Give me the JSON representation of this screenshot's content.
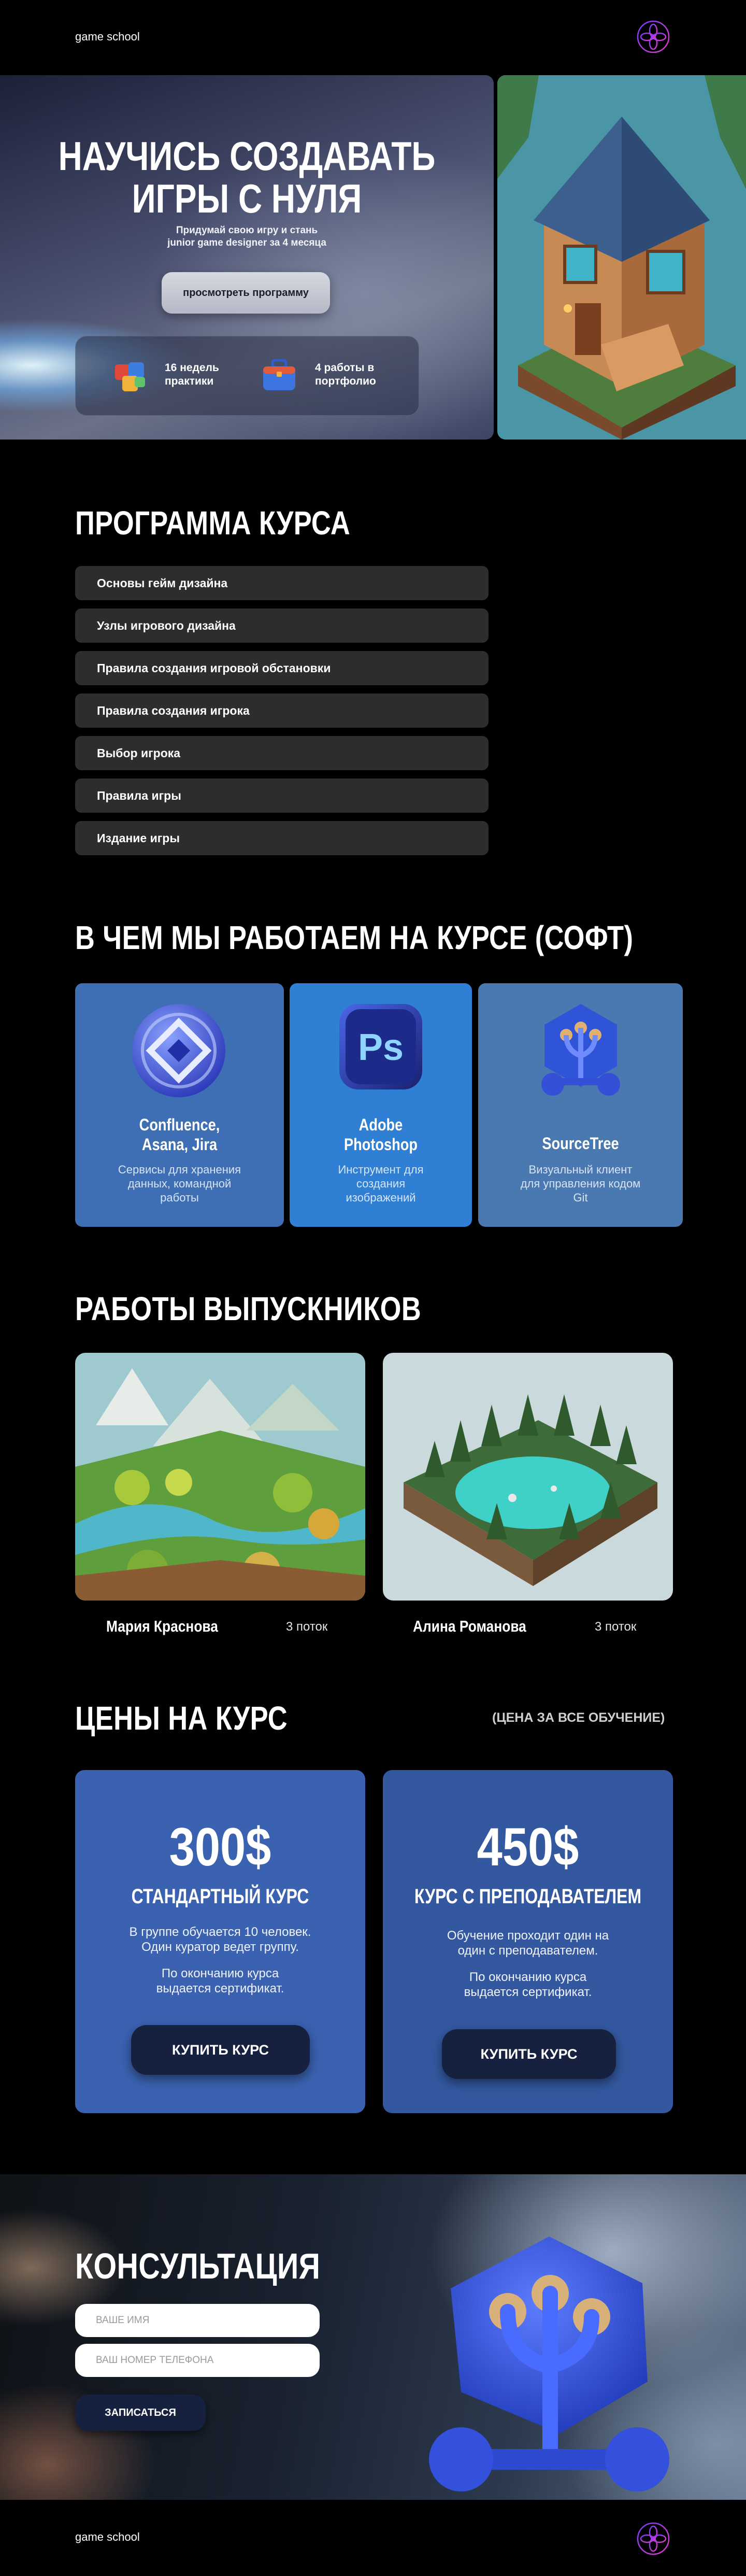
{
  "header": {
    "brand": "game school",
    "logo_icon": "neural-flower-icon"
  },
  "hero": {
    "title_line1": "НАУЧИСЬ СОЗДАВАТЬ",
    "title_line2": "ИГРЫ С НУЛЯ",
    "subtitle_line1": "Придумай свою игру и стань",
    "subtitle_line2": "junior game designer за 4 месяца",
    "button_label": "просмотреть программу",
    "stats": [
      {
        "icon": "puzzle-cube-icon",
        "line1": "16 недель",
        "line2": "практики"
      },
      {
        "icon": "briefcase-icon",
        "line1": "4 работы в",
        "line2": "портфолио"
      }
    ]
  },
  "program": {
    "title": "ПРОГРАММА КУРСА",
    "items": [
      "Основы гейм дизайна",
      "Узлы игрового дизайна",
      "Правила создания игровой обстановки",
      "Правила создания игрока",
      "Выбор игрока",
      "Правила игры",
      "Издание игры"
    ]
  },
  "soft": {
    "title": "В ЧЕМ МЫ РАБОТАЕМ НА КУРСЕ (СОФТ)",
    "cards": [
      {
        "icon": "confluence-icon",
        "name_line1": "Confluence,",
        "name_line2": "Asana, Jira",
        "desc_line1": "Сервисы для хранения",
        "desc_line2": "данных, командной",
        "desc_line3": "работы",
        "bg": "#3e6fb4"
      },
      {
        "icon": "photoshop-icon",
        "name_line1": "Adobe",
        "name_line2": "Photoshop",
        "desc_line1": "Инструмент для",
        "desc_line2": "создания",
        "desc_line3": "изображений",
        "bg": "#2f7fd4"
      },
      {
        "icon": "sourcetree-icon",
        "name_line1": "SourceTree",
        "name_line2": "",
        "desc_line1": "Визуальный клиент",
        "desc_line2": "для управления кодом",
        "desc_line3": "Git",
        "bg": "#4a78b0"
      }
    ]
  },
  "graduates": {
    "title": "РАБОТЫ ВЫПУСКНИКОВ",
    "items": [
      {
        "name": "Мария Краснова",
        "stream": "3 поток"
      },
      {
        "name": "Алина Романова",
        "stream": "3 поток"
      }
    ]
  },
  "prices": {
    "title": "ЦЕНЫ НА КУРС",
    "note": "(ЦЕНА ЗА ВСЕ ОБУЧЕНИЕ)",
    "cards": [
      {
        "price": "300$",
        "name": "СТАНДАРТНЫЙ КУРС",
        "text1_line1": "В группе обучается 10 человек.",
        "text1_line2": "Один куратор  ведет группу.",
        "text2_line1": "По окончанию курса",
        "text2_line2": "выдается сертификат.",
        "button": "КУПИТЬ КУРС"
      },
      {
        "price": "450$",
        "name": "КУРС С ПРЕПОДАВАТЕЛЕМ",
        "text1_line1": "Обучение проходит один на",
        "text1_line2": "один с преподавателем.",
        "text2_line1": "По окончанию курса",
        "text2_line2": "выдается сертификат.",
        "button": "КУПИТЬ КУРС"
      }
    ]
  },
  "consult": {
    "title": "КОНСУЛЬТАЦИЯ",
    "name_placeholder": "ваше имя",
    "phone_placeholder": "ваш номер телефона",
    "button": "ЗАПИСАТЬСЯ"
  },
  "footer": {
    "brand": "game school",
    "logo_icon": "neural-flower-icon"
  },
  "colors": {
    "card_blue": "#3a62b0",
    "program_item": "#2d2d2d",
    "button_dark": "#16213f"
  }
}
